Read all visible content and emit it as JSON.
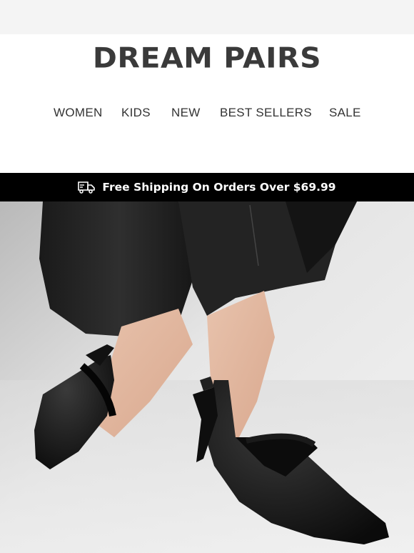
{
  "brand": {
    "logo_text": "DREAM PAIRS"
  },
  "nav": {
    "items": [
      {
        "label": "WOMEN"
      },
      {
        "label": "KIDS"
      },
      {
        "label": "NEW"
      },
      {
        "label": "BEST SELLERS"
      },
      {
        "label": "SALE"
      }
    ]
  },
  "promo_bar": {
    "icon": "truck-icon",
    "text": "Free Shipping On Orders Over $69.99"
  },
  "colors": {
    "background": "#ffffff",
    "top_strip": "#f4f4f4",
    "text_dark": "#3a3a3a",
    "promo_bg": "#000000",
    "promo_text": "#ffffff"
  }
}
